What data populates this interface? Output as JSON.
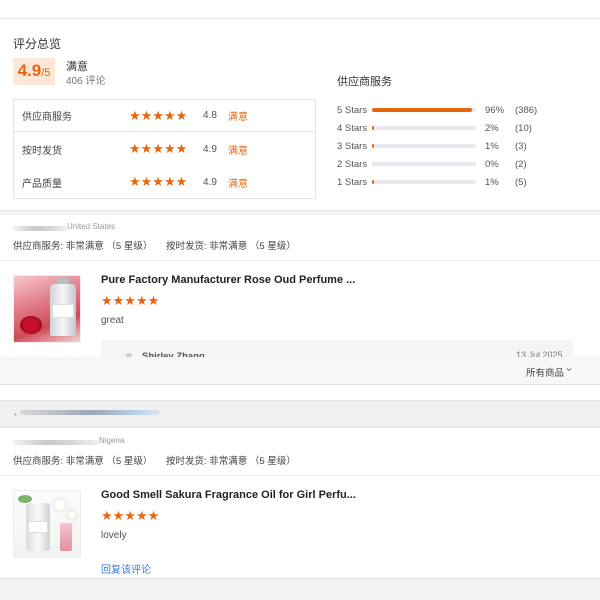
{
  "summary": {
    "title": "评分总览",
    "score": "4.9",
    "score_max": "/5",
    "satisfaction": "满意",
    "review_count": "406 评论",
    "metrics": [
      {
        "label": "供应商服务",
        "stars": "★★★★★",
        "score": "4.8",
        "level": "满意"
      },
      {
        "label": "按时发货",
        "stars": "★★★★★",
        "score": "4.9",
        "level": "满意"
      },
      {
        "label": "产品质量",
        "stars": "★★★★★",
        "score": "4.9",
        "level": "满意"
      }
    ],
    "distribution_title": "供应商服务",
    "distribution": [
      {
        "label": "5 Stars",
        "percent_text": "96%",
        "count": "(386)",
        "fraction": 0.96
      },
      {
        "label": "4 Stars",
        "percent_text": "2%",
        "count": "(10)",
        "fraction": 0.02
      },
      {
        "label": "3 Stars",
        "percent_text": "1%",
        "count": "(3)",
        "fraction": 0.01
      },
      {
        "label": "2 Stars",
        "percent_text": "0%",
        "count": "(2)",
        "fraction": 0.0
      },
      {
        "label": "1 Stars",
        "percent_text": "1%",
        "count": "(5)",
        "fraction": 0.01
      }
    ],
    "accent_color": "#e8650f"
  },
  "reviews": [
    {
      "country": "United States",
      "eval_supplier": "供应商服务: 非常满意 （5 星级）",
      "eval_shipping": "按时发货: 非常满意 （5 星级）",
      "product_title": "Pure Factory Manufacturer Rose Oud Perfume ...",
      "stars": "★★★★★",
      "text": "great",
      "reply_name": "Shirley Zhang",
      "reply_date": "13 Jul 2025"
    },
    {
      "country": "Nigeria",
      "eval_supplier": "供应商服务: 非常满意 （5 星级）",
      "eval_shipping": "按时发货: 非常满意 （5 星级）",
      "product_title": "Good Smell Sakura Fragrance Oil for Girl Perfu...",
      "stars": "★★★★★",
      "text": "lovely",
      "reply_link": "回复该评论"
    }
  ],
  "filter": {
    "all_products": "所有商品",
    "chevron_icon": "chevron-down-icon"
  }
}
